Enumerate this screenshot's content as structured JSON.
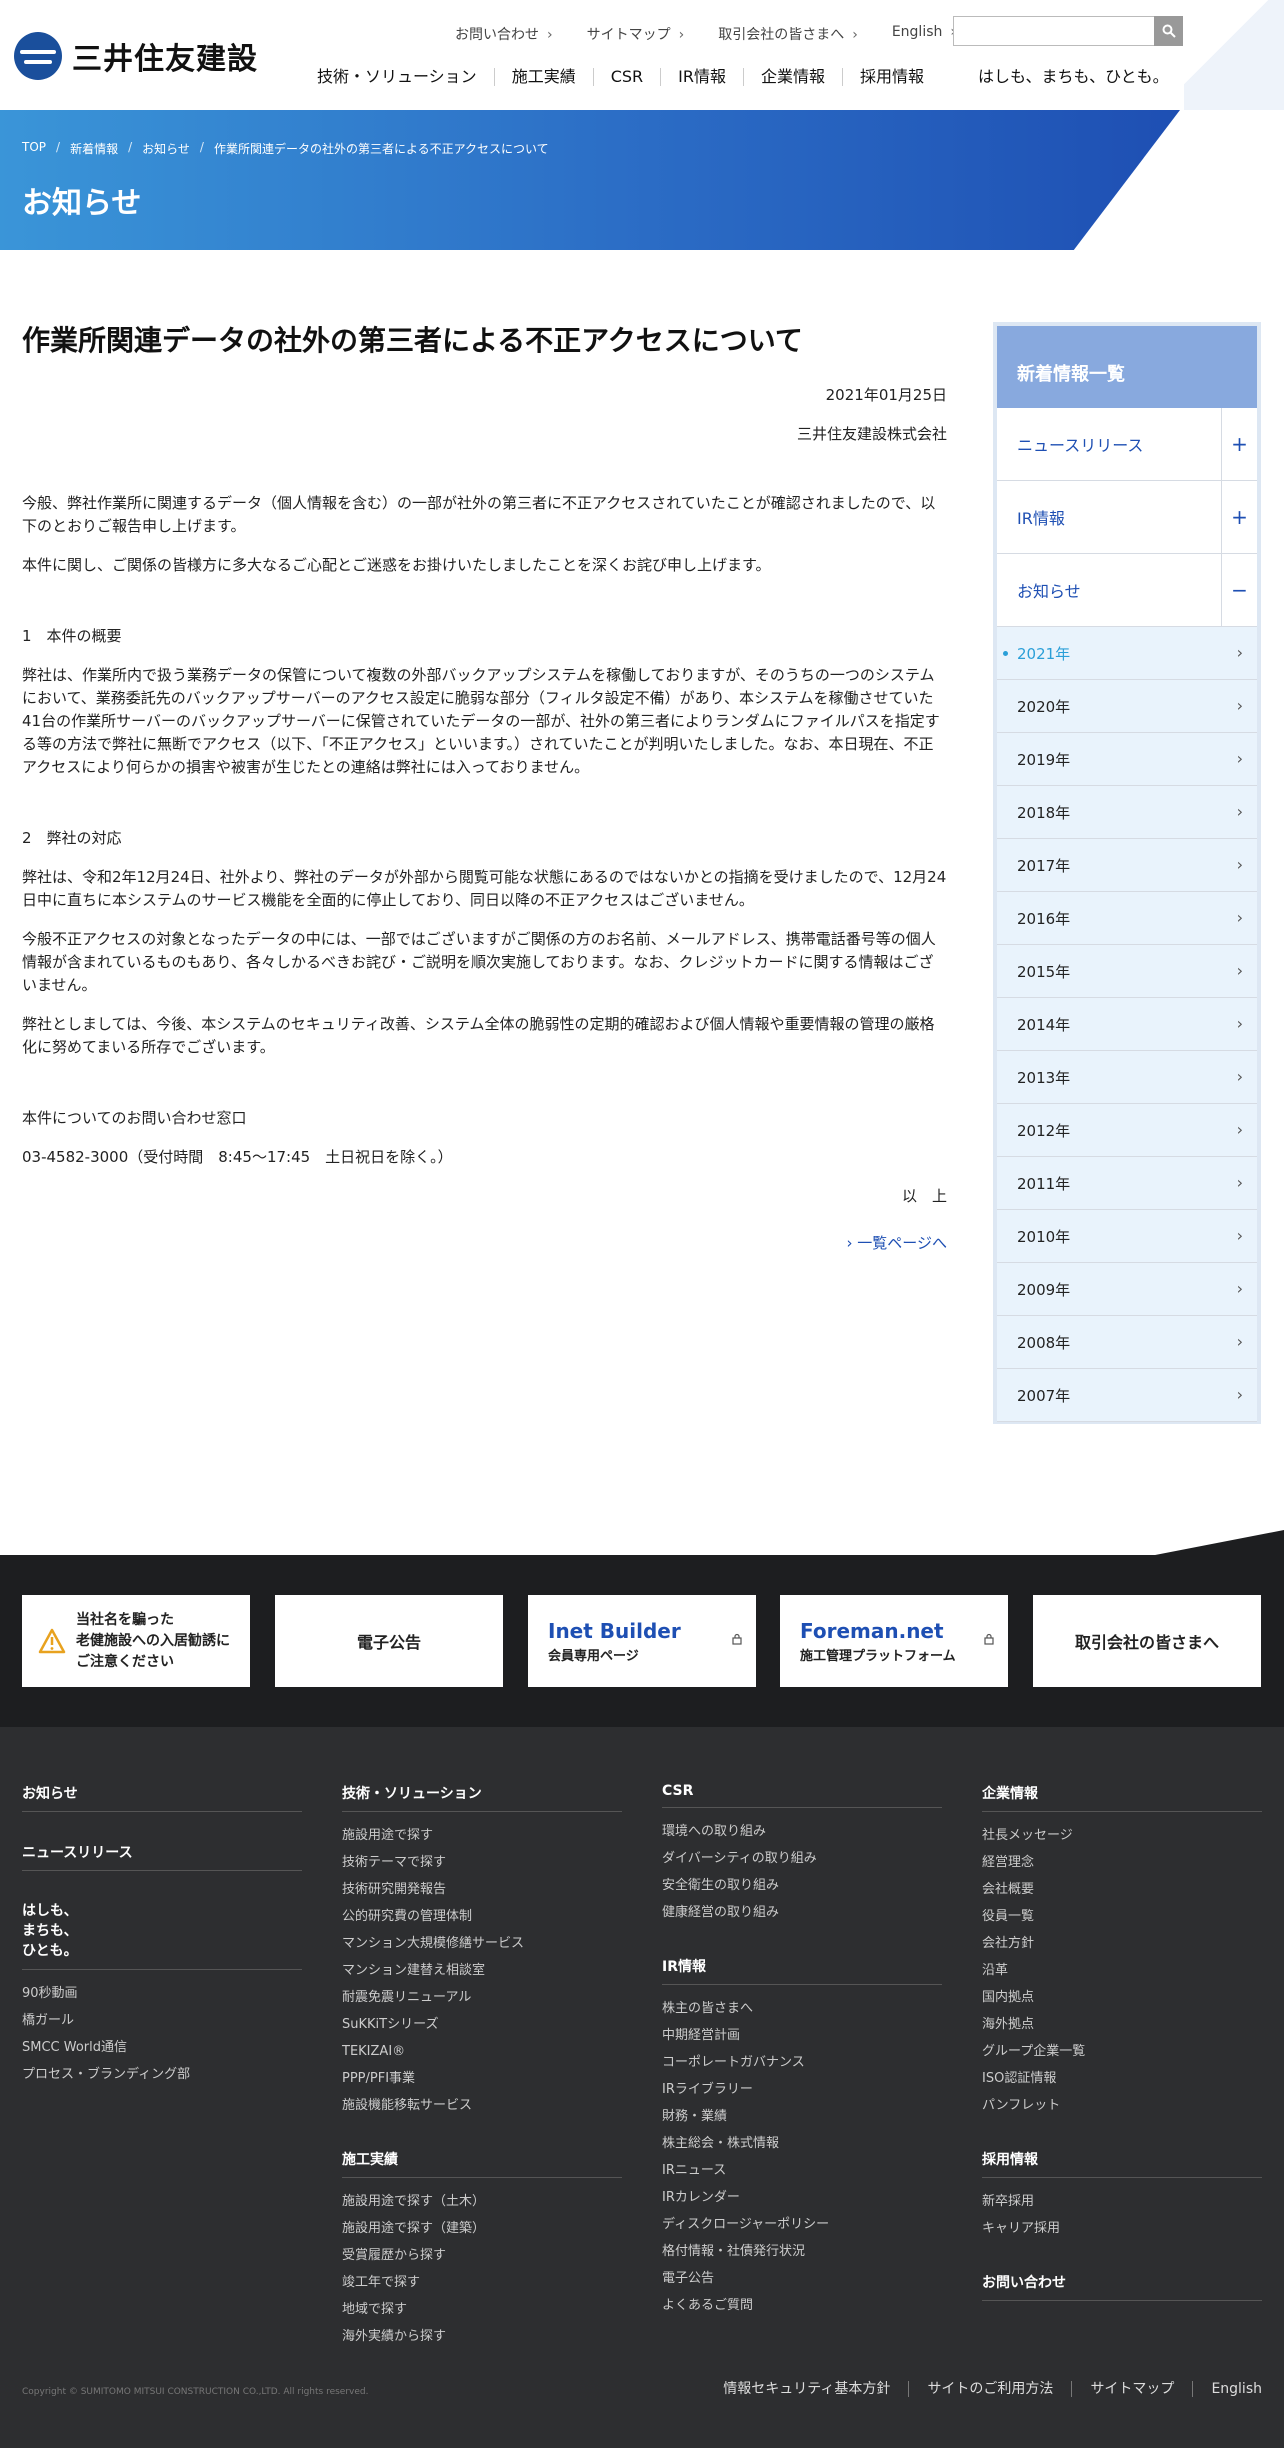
{
  "header": {
    "logo_text": "三井住友建設",
    "util": [
      {
        "label": "お問い合わせ"
      },
      {
        "label": "サイトマップ"
      },
      {
        "label": "取引会社の皆さまへ"
      },
      {
        "label": "English"
      }
    ],
    "search_placeholder": "",
    "search_icon": "search-icon",
    "gnav": [
      {
        "label": "技術・ソリューション"
      },
      {
        "label": "施工実績"
      },
      {
        "label": "CSR"
      },
      {
        "label": "IR情報"
      },
      {
        "label": "企業情報"
      },
      {
        "label": "採用情報"
      }
    ],
    "tagline": "はしも、まちも、ひとも。"
  },
  "hero": {
    "breadcrumb": [
      {
        "label": "TOP"
      },
      {
        "label": "新着情報"
      },
      {
        "label": "お知らせ"
      },
      {
        "label": "作業所関連データの社外の第三者による不正アクセスについて"
      }
    ],
    "title": "お知らせ"
  },
  "article": {
    "title": "作業所関連データの社外の第三者による不正アクセスについて",
    "date": "2021年01月25日",
    "company": "三井住友建設株式会社",
    "intro": [
      "今般、弊社作業所に関連するデータ（個人情報を含む）の一部が社外の第三者に不正アクセスされていたことが確認されましたので、以下のとおりご報告申し上げます。",
      "本件に関し、ご関係の皆様方に多大なるご心配とご迷惑をお掛けいたしましたことを深くお詫び申し上げます。"
    ],
    "section1_heading": "1　本件の概要",
    "section1": [
      "弊社は、作業所内で扱う業務データの保管について複数の外部バックアップシステムを稼働しておりますが、そのうちの一つのシステムにおいて、業務委託先のバックアップサーバーのアクセス設定に脆弱な部分（フィルタ設定不備）があり、本システムを稼働させていた41台の作業所サーバーのバックアップサーバーに保管されていたデータの一部が、社外の第三者によりランダムにファイルパスを指定する等の方法で弊社に無断でアクセス（以下、「不正アクセス」といいます。）されていたことが判明いたしました。なお、本日現在、不正アクセスにより何らかの損害や被害が生じたとの連絡は弊社には入っておりません。"
    ],
    "section2_heading": "2　弊社の対応",
    "section2": [
      "弊社は、令和2年12月24日、社外より、弊社のデータが外部から閲覧可能な状態にあるのではないかとの指摘を受けましたので、12月24日中に直ちに本システムのサービス機能を全面的に停止しており、同日以降の不正アクセスはございません。",
      "今般不正アクセスの対象となったデータの中には、一部ではございますがご関係の方のお名前、メールアドレス、携帯電話番号等の個人情報が含まれているものもあり、各々しかるべきお詫び・ご説明を順次実施しております。なお、クレジットカードに関する情報はございません。",
      "弊社としましては、今後、本システムのセキュリティ改善、システム全体の脆弱性の定期的確認および個人情報や重要情報の管理の厳格化に努めてまいる所存でございます。"
    ],
    "contact_title": "本件についてのお問い合わせ窓口",
    "contact": "03-4582-3000（受付時間　8:45～17:45　土日祝日を除く。）",
    "closing": "以　上",
    "back_link": "› 一覧ページへ"
  },
  "sidebar": {
    "title": "新着情報一覧",
    "categories": [
      {
        "label": "ニュースリリース",
        "toggle": "+"
      },
      {
        "label": "IR情報",
        "toggle": "+"
      },
      {
        "label": "お知らせ",
        "toggle": "−"
      }
    ],
    "years": [
      "2021年",
      "2020年",
      "2019年",
      "2018年",
      "2017年",
      "2016年",
      "2015年",
      "2014年",
      "2013年",
      "2012年",
      "2011年",
      "2010年",
      "2009年",
      "2008年",
      "2007年"
    ],
    "active_year": "2021年"
  },
  "banners": {
    "warning_lines": [
      "当社名を騙った",
      "老健施設への入居勧誘に",
      "ご注意ください"
    ],
    "koukoku": "電子公告",
    "inet_title": "Inet Builder",
    "inet_sub": "会員専用ページ",
    "foreman_title": "Foreman.net",
    "foreman_sub": "施工管理プラットフォーム",
    "partners": "取引会社の皆さまへ"
  },
  "footer": {
    "col1": {
      "head1": "お知らせ",
      "head2": "ニュースリリース",
      "head3_lines": [
        "はしも、",
        "まちも、",
        "ひとも。"
      ],
      "links": [
        "90秒動画",
        "橋ガール",
        "SMCC World通信",
        "プロセス・ブランディング部"
      ]
    },
    "col2": {
      "head1": "技術・ソリューション",
      "links1": [
        "施設用途で探す",
        "技術テーマで探す",
        "技術研究開発報告",
        "公的研究費の管理体制",
        "マンション大規模修繕サービス",
        "マンション建替え相談室",
        "耐震免震リニューアル",
        "SuKKiTシリーズ",
        "TEKIZAI®",
        "PPP/PFI事業",
        "施設機能移転サービス"
      ],
      "head2": "施工実績",
      "links2": [
        "施設用途で探す（土木）",
        "施設用途で探す（建築）",
        "受賞履歴から探す",
        "竣工年で探す",
        "地域で探す",
        "海外実績から探す"
      ]
    },
    "col3": {
      "head1": "CSR",
      "links1": [
        "環境への取り組み",
        "ダイバーシティの取り組み",
        "安全衛生の取り組み",
        "健康経営の取り組み"
      ],
      "head2": "IR情報",
      "links2": [
        "株主の皆さまへ",
        "中期経営計画",
        "コーポレートガバナンス",
        "IRライブラリー",
        "財務・業績",
        "株主総会・株式情報",
        "IRニュース",
        "IRカレンダー",
        "ディスクロージャーポリシー",
        "格付情報・社債発行状況",
        "電子公告",
        "よくあるご質問"
      ]
    },
    "col4": {
      "head1": "企業情報",
      "links1": [
        "社長メッセージ",
        "経営理念",
        "会社概要",
        "役員一覧",
        "会社方針",
        "沿革",
        "国内拠点",
        "海外拠点",
        "グループ企業一覧",
        "ISO認証情報",
        "パンフレット"
      ],
      "head2": "採用情報",
      "links2": [
        "新卒採用",
        "キャリア採用"
      ],
      "head3": "お問い合わせ"
    },
    "copyright": "Copyright © SUMITOMO MITSUI CONSTRUCTION CO.,LTD. All rights reserved.",
    "bottom_links": [
      "情報セキュリティ基本方針",
      "サイトのご利用方法",
      "サイトマップ",
      "English"
    ]
  }
}
